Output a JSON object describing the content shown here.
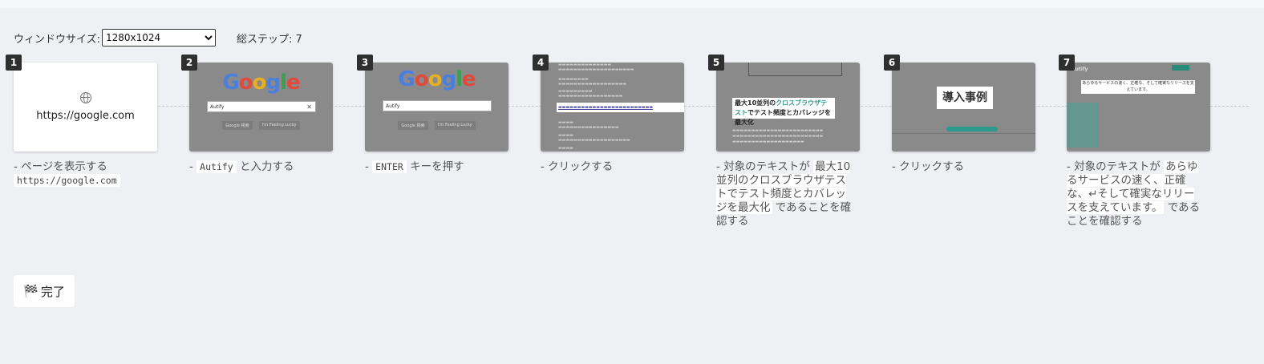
{
  "toolbar": {
    "window_size_label": "ウィンドウサイズ:",
    "window_size_value": "1280x1024",
    "total_steps_label": "総ステップ: 7"
  },
  "steps": [
    {
      "num": "1",
      "thumb_text": "https://google.com",
      "desc_prefix": "- ページを表示する",
      "desc_code": "https://google.com"
    },
    {
      "num": "2",
      "search_text": "Autify",
      "desc_prefix": "- ",
      "desc_code": "Autify",
      "desc_suffix": " と入力する"
    },
    {
      "num": "3",
      "search_text": "Autify",
      "desc_prefix": "- ",
      "desc_code": "ENTER",
      "desc_suffix": " キーを押す"
    },
    {
      "num": "4",
      "desc_text": "- クリックする"
    },
    {
      "num": "5",
      "thumb_text_a": "最大10並列の",
      "thumb_text_b": "クロスブラウザテスト",
      "thumb_text_c": "でテスト頻度とカバレッジを最大化",
      "desc_prefix": "- 対象のテキストが ",
      "desc_hl": "最大10並列のクロスブラウザテストでテスト頻度とカバレッジを最大化",
      "desc_suffix": " であることを確認する"
    },
    {
      "num": "6",
      "thumb_text": "導入事例",
      "desc_text": "- クリックする"
    },
    {
      "num": "7",
      "thumb_brand": "Autify",
      "thumb_text": "あらゆるサービスの速く、正確な、そして確実なリリースを支えています。",
      "desc_prefix": "- 対象のテキストが ",
      "desc_hl": "あらゆるサービスの速く、正確な、↵そして確実なリリースを支えています。",
      "desc_suffix": " であることを確認する"
    }
  ],
  "google": {
    "logo": [
      "G",
      "o",
      "o",
      "g",
      "l",
      "e"
    ],
    "btn_search": "Google 検索",
    "btn_lucky": "I'm Feeling Lucky"
  },
  "finish": {
    "label": "完了"
  }
}
